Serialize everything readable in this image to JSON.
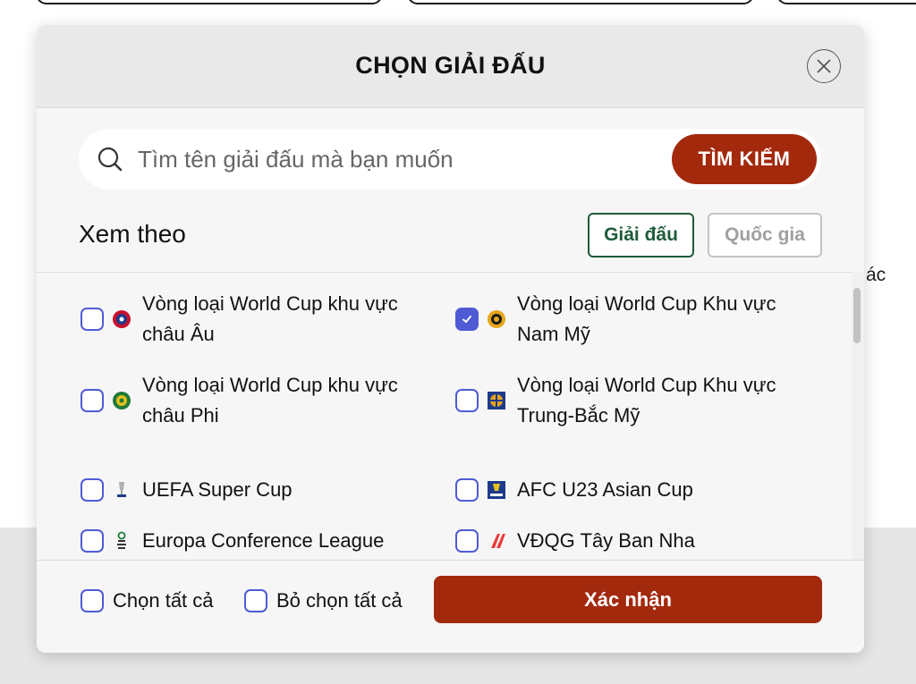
{
  "background": {
    "partial_text": "ác"
  },
  "modal": {
    "title": "CHỌN GIẢI ĐẤU",
    "close_icon": "close-icon"
  },
  "search": {
    "placeholder": "Tìm tên giải đấu mà bạn muốn",
    "button_label": "TÌM KIẾM"
  },
  "view_by": {
    "label": "Xem theo",
    "options": [
      {
        "label": "Giải đấu",
        "active": true
      },
      {
        "label": "Quốc gia",
        "active": false
      }
    ]
  },
  "leagues": [
    {
      "label": "Vòng loại World Cup khu vực châu Âu",
      "checked": false,
      "icon": "uefa-logo-icon"
    },
    {
      "label": "Vòng loại World Cup Khu vực Nam Mỹ",
      "checked": true,
      "icon": "conmebol-logo-icon"
    },
    {
      "label": "Vòng loại World Cup khu vực châu Phi",
      "checked": false,
      "icon": "caf-logo-icon"
    },
    {
      "label": "Vòng loại World Cup Khu vực Trung-Bắc Mỹ",
      "checked": false,
      "icon": "concacaf-logo-icon"
    },
    {
      "label": "UEFA Super Cup",
      "checked": false,
      "icon": "uefa-super-cup-trophy-icon"
    },
    {
      "label": "AFC U23 Asian Cup",
      "checked": false,
      "icon": "afc-u23-logo-icon"
    },
    {
      "label": "Europa Conference League",
      "checked": false,
      "icon": "conference-league-logo-icon"
    },
    {
      "label": "VĐQG Tây Ban Nha",
      "checked": false,
      "icon": "laliga-logo-icon"
    }
  ],
  "footer": {
    "select_all_label": "Chọn tất cả",
    "deselect_all_label": "Bỏ chọn tất cả",
    "confirm_label": "Xác nhận"
  },
  "colors": {
    "primary": "#a3290d",
    "checkbox": "#4f5bd5",
    "active_tab": "#1f5c3a"
  }
}
